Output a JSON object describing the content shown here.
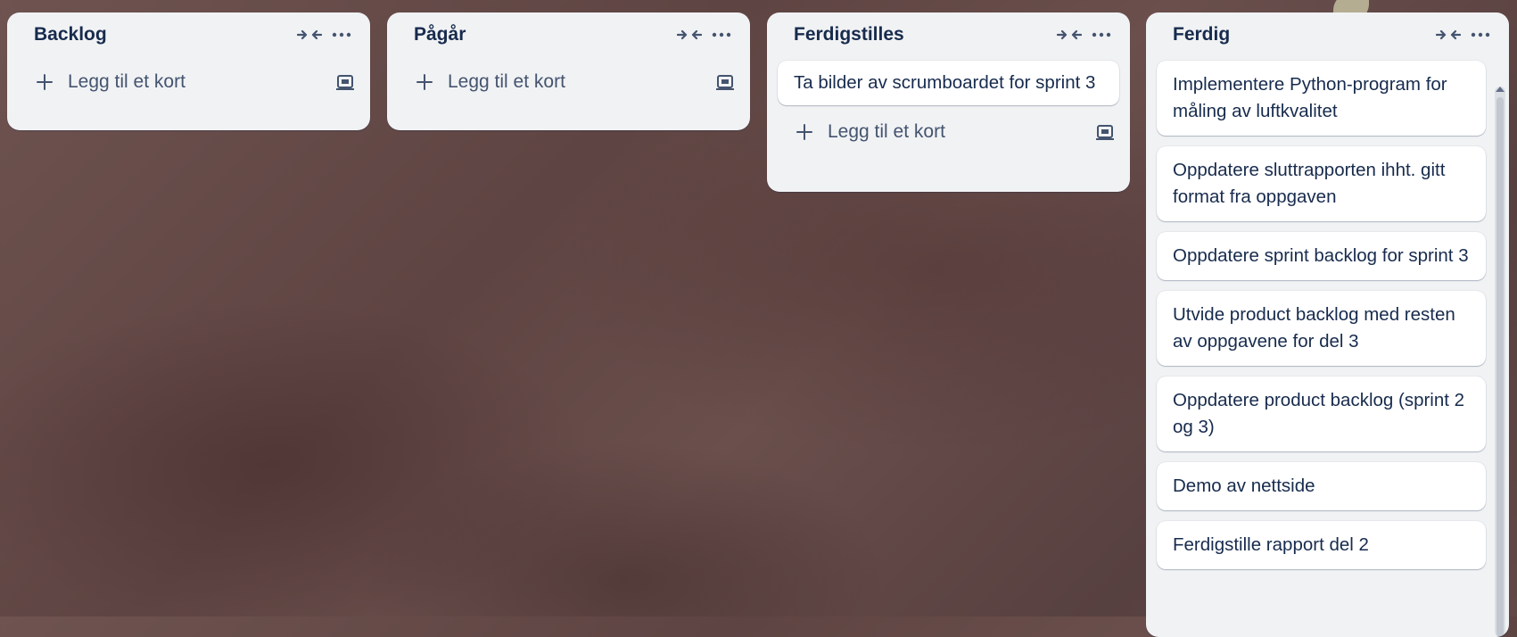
{
  "lists": [
    {
      "title": "Backlog",
      "cards": [],
      "add_card_label": "Legg til et kort"
    },
    {
      "title": "Pågår",
      "cards": [],
      "add_card_label": "Legg til et kort"
    },
    {
      "title": "Ferdigstilles",
      "cards": [
        "Ta bilder av scrumboardet for sprint 3"
      ],
      "add_card_label": "Legg til et kort"
    },
    {
      "title": "Ferdig",
      "cards": [
        "Implementere Python-program for måling av luftkvalitet",
        "Oppdatere sluttrapporten ihht. gitt format fra oppgaven",
        "Oppdatere sprint backlog for sprint 3",
        "Utvide product backlog med resten av oppgavene for del 3",
        "Oppdatere product backlog (sprint 2 og 3)",
        "Demo av nettside",
        "Ferdigstille rapport del 2"
      ]
    }
  ],
  "icons": {
    "collapse": "collapse-icon",
    "more": "more-icon",
    "plus": "plus-icon",
    "template": "template-icon"
  },
  "colors": {
    "list_bg": "#f1f2f4",
    "card_bg": "#ffffff",
    "text": "#172b4d",
    "muted": "#44546f"
  }
}
